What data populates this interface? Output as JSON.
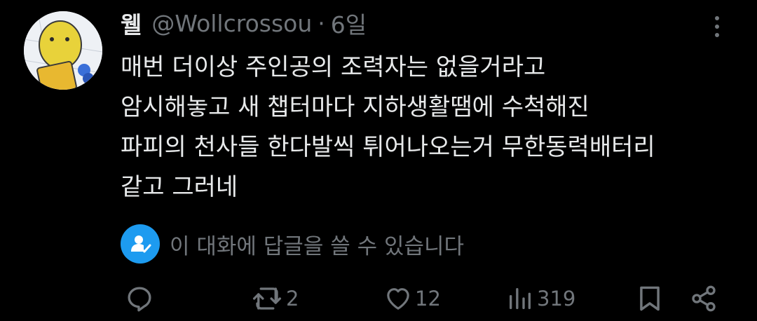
{
  "tweet": {
    "author_name": "웰",
    "handle": "@Wollcrossou",
    "separator": "·",
    "time": "6일",
    "text_lines": [
      "매번 더이상 주인공의 조력자는 없을거라고",
      "암시해놓고 새 챕터마다 지하생활땜에 수척해진",
      "파피의 천사들 한다발씩 튀어나오는거 무한동력배터리",
      "같고 그러네"
    ]
  },
  "reply_notice": {
    "icon": "person-check-icon",
    "text": "이 대화에 답글을 쓸 수 있습니다"
  },
  "actions": {
    "reply": {
      "icon": "reply-icon",
      "count": ""
    },
    "retweet": {
      "icon": "retweet-icon",
      "count": "2"
    },
    "like": {
      "icon": "heart-icon",
      "count": "12"
    },
    "views": {
      "icon": "views-icon",
      "count": "319"
    },
    "bookmark": {
      "icon": "bookmark-icon"
    },
    "share": {
      "icon": "share-icon"
    }
  },
  "colors": {
    "background": "#000000",
    "primary_text": "#e7e9ea",
    "secondary_text": "#71767b",
    "accent": "#1d9bf0"
  }
}
